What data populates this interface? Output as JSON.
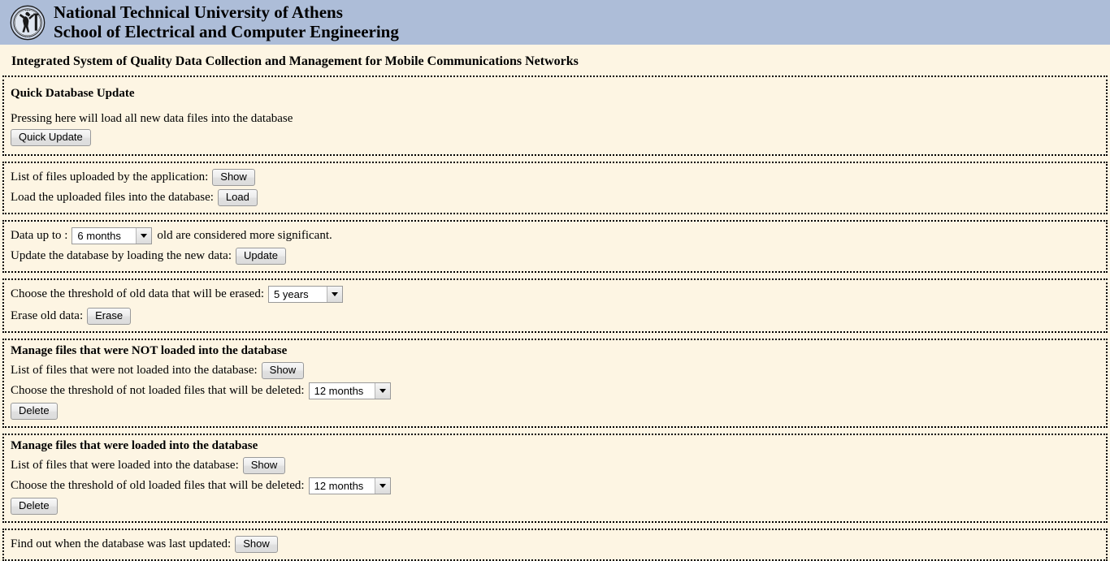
{
  "header": {
    "logo_icon": "ntua-seal-icon",
    "line1": "National Technical University of Athens",
    "line2": "School of Electrical and Computer Engineering",
    "background_color": "#adbdd8"
  },
  "page": {
    "title": "Integrated System of Quality Data Collection and Management for Mobile Communications Networks",
    "background_color": "#fdf5e3"
  },
  "sections": {
    "quick_update": {
      "heading": "Quick Database Update",
      "description": "Pressing here will load all new data files into the database",
      "button_label": "Quick Update"
    },
    "uploaded_files": {
      "list_label": "List of files uploaded by the application:",
      "list_button": "Show",
      "load_label": "Load the uploaded files into the database:",
      "load_button": "Load"
    },
    "significance": {
      "prefix_label": "Data up to :",
      "select_value": "6 months",
      "suffix_label": "old are considered more significant.",
      "update_label": "Update the database by loading the new data:",
      "update_button": "Update"
    },
    "erase_old": {
      "threshold_label": "Choose the threshold of old data that will be erased:",
      "select_value": "5 years",
      "erase_label": "Erase old data:",
      "erase_button": "Erase"
    },
    "not_loaded": {
      "heading": "Manage files that were NOT loaded into the database",
      "list_label": "List of files that were not loaded into the database:",
      "list_button": "Show",
      "threshold_label": "Choose the threshold of not loaded files that will be deleted:",
      "select_value": "12 months",
      "delete_button": "Delete"
    },
    "loaded": {
      "heading": "Manage files that were loaded into the database",
      "list_label": "List of files that were loaded into the database:",
      "list_button": "Show",
      "threshold_label": "Choose the threshold of old loaded files that will be deleted:",
      "select_value": "12 months",
      "delete_button": "Delete"
    },
    "last_updated": {
      "label": "Find out when the database was last updated:",
      "button_label": "Show"
    }
  }
}
